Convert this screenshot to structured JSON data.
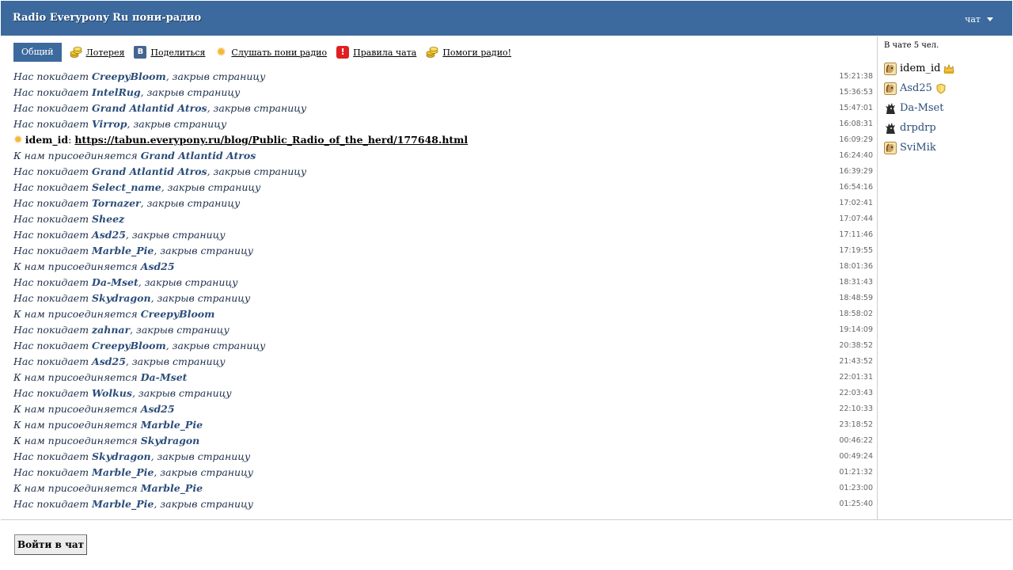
{
  "header": {
    "title": "Radio Everypony Ru пони-радио",
    "menu_label": "чат"
  },
  "toolbar": {
    "tab_general": "Общий",
    "links": [
      {
        "label": "Лотерея",
        "icon": "coins-icon"
      },
      {
        "label": "Поделиться",
        "icon": "vk-icon"
      },
      {
        "label": "Слушать пони радио",
        "icon": "sun-icon"
      },
      {
        "label": "Правила чата",
        "icon": "warning-icon"
      },
      {
        "label": "Помоги радио!",
        "icon": "coins-icon"
      }
    ]
  },
  "messages": [
    {
      "type": "leave",
      "prefix": "Нас покидает",
      "user": "CreepyBloom",
      "suffix": ", закрыв страницу",
      "time": "15:21:38"
    },
    {
      "type": "leave",
      "prefix": "Нас покидает",
      "user": "IntelRug",
      "suffix": ", закрыв страницу",
      "time": "15:36:53"
    },
    {
      "type": "leave",
      "prefix": "Нас покидает",
      "user": "Grand Atlantid Atros",
      "suffix": ", закрыв страницу",
      "time": "15:47:01"
    },
    {
      "type": "leave",
      "prefix": "Нас покидает",
      "user": "Virrop",
      "suffix": ", закрыв страницу",
      "time": "16:08:31"
    },
    {
      "type": "chat",
      "author": "idem_id",
      "link": "https://tabun.everypony.ru/blog/Public_Radio_of_the_herd/177648.html",
      "time": "16:09:29"
    },
    {
      "type": "join",
      "prefix": "К нам присоединяется",
      "user": "Grand Atlantid Atros",
      "suffix": "",
      "time": "16:24:40"
    },
    {
      "type": "leave",
      "prefix": "Нас покидает",
      "user": "Grand Atlantid Atros",
      "suffix": ", закрыв страницу",
      "time": "16:39:29"
    },
    {
      "type": "leave",
      "prefix": "Нас покидает",
      "user": "Select_name",
      "suffix": ", закрыв страницу",
      "time": "16:54:16"
    },
    {
      "type": "leave",
      "prefix": "Нас покидает",
      "user": "Tornazer",
      "suffix": ", закрыв страницу",
      "time": "17:02:41"
    },
    {
      "type": "leave",
      "prefix": "Нас покидает",
      "user": "Sheez",
      "suffix": "",
      "time": "17:07:44"
    },
    {
      "type": "leave",
      "prefix": "Нас покидает",
      "user": "Asd25",
      "suffix": ", закрыв страницу",
      "time": "17:11:46"
    },
    {
      "type": "leave",
      "prefix": "Нас покидает",
      "user": "Marble_Pie",
      "suffix": ", закрыв страницу",
      "time": "17:19:55"
    },
    {
      "type": "join",
      "prefix": "К нам присоединяется",
      "user": "Asd25",
      "suffix": "",
      "time": "18:01:36"
    },
    {
      "type": "leave",
      "prefix": "Нас покидает",
      "user": "Da-Mset",
      "suffix": ", закрыв страницу",
      "time": "18:31:43"
    },
    {
      "type": "leave",
      "prefix": "Нас покидает",
      "user": "Skydragon",
      "suffix": ", закрыв страницу",
      "time": "18:48:59"
    },
    {
      "type": "join",
      "prefix": "К нам присоединяется",
      "user": "CreepyBloom",
      "suffix": "",
      "time": "18:58:02"
    },
    {
      "type": "leave",
      "prefix": "Нас покидает",
      "user": "zahnar",
      "suffix": ", закрыв страницу",
      "time": "19:14:09"
    },
    {
      "type": "leave",
      "prefix": "Нас покидает",
      "user": "CreepyBloom",
      "suffix": ", закрыв страницу",
      "time": "20:38:52"
    },
    {
      "type": "leave",
      "prefix": "Нас покидает",
      "user": "Asd25",
      "suffix": ", закрыв страницу",
      "time": "21:43:52"
    },
    {
      "type": "join",
      "prefix": "К нам присоединяется",
      "user": "Da-Mset",
      "suffix": "",
      "time": "22:01:31"
    },
    {
      "type": "leave",
      "prefix": "Нас покидает",
      "user": "Wolkus",
      "suffix": ", закрыв страницу",
      "time": "22:03:43"
    },
    {
      "type": "join",
      "prefix": "К нам присоединяется",
      "user": "Asd25",
      "suffix": "",
      "time": "22:10:33"
    },
    {
      "type": "join",
      "prefix": "К нам присоединяется",
      "user": "Marble_Pie",
      "suffix": "",
      "time": "23:18:52"
    },
    {
      "type": "join",
      "prefix": "К нам присоединяется",
      "user": "Skydragon",
      "suffix": "",
      "time": "00:46:22"
    },
    {
      "type": "leave",
      "prefix": "Нас покидает",
      "user": "Skydragon",
      "suffix": ", закрыв страницу",
      "time": "00:49:24"
    },
    {
      "type": "leave",
      "prefix": "Нас покидает",
      "user": "Marble_Pie",
      "suffix": ", закрыв страницу",
      "time": "01:21:32"
    },
    {
      "type": "join",
      "prefix": "К нам присоединяется",
      "user": "Marble_Pie",
      "suffix": "",
      "time": "01:23:00"
    },
    {
      "type": "leave",
      "prefix": "Нас покидает",
      "user": "Marble_Pie",
      "suffix": ", закрыв страницу",
      "time": "01:25:40"
    }
  ],
  "sidebar": {
    "online_count": "В чате 5 чел.",
    "users": [
      {
        "name": "idem_id",
        "avatar": "pony-avatar-icon",
        "badge": "crown-icon",
        "self": true
      },
      {
        "name": "Asd25",
        "avatar": "pony-avatar-icon",
        "badge": "shield-icon",
        "self": false
      },
      {
        "name": "Da-Mset",
        "avatar": "dark-pony-avatar-icon",
        "badge": "",
        "self": false
      },
      {
        "name": "drpdrp",
        "avatar": "dark-pony-avatar-icon",
        "badge": "",
        "self": false
      },
      {
        "name": "SviMik",
        "avatar": "pony-avatar-icon",
        "badge": "",
        "self": false
      }
    ]
  },
  "footer": {
    "login_button": "Войти в чат"
  },
  "colors": {
    "accent": "#3c6a9e",
    "username": "#2b4d7a",
    "system_text": "#1d2f4a"
  }
}
